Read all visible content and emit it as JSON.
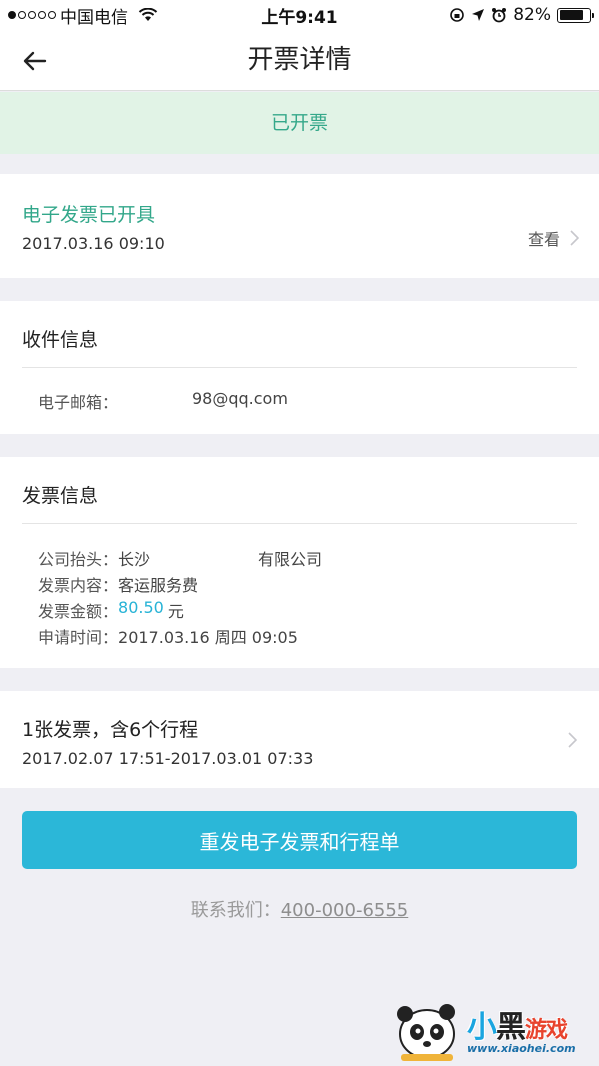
{
  "status_bar": {
    "carrier": "中国电信",
    "time": "上午9:41",
    "battery": "82%",
    "battery_level": 0.82
  },
  "nav": {
    "title": "开票详情"
  },
  "banner": {
    "status": "已开票"
  },
  "einvoice": {
    "title": "电子发票已开具",
    "time": "2017.03.16 09:10",
    "view_label": "查看"
  },
  "recipient": {
    "title": "收件信息",
    "email_label": "电子邮箱：",
    "email_value": "98@qq.com"
  },
  "invoice": {
    "title": "发票信息",
    "company_label": "公司抬头：",
    "company_part1": "长沙",
    "company_part2": "有限公司",
    "content_label": "发票内容：",
    "content_value": "客运服务费",
    "amount_label": "发票金额：",
    "amount_value": "80.50",
    "amount_unit": "元",
    "apply_label": "申请时间：",
    "apply_value": "2017.03.16 周四 09:05"
  },
  "trips": {
    "summary": "1张发票，含6个行程",
    "range": "2017.02.07 17:51-2017.03.01 07:33"
  },
  "actions": {
    "resend_label": "重发电子发票和行程单"
  },
  "contact": {
    "label": "联系我们：",
    "phone": "400-000-6555"
  },
  "watermark": {
    "brand_a": "小",
    "brand_b": "黑",
    "brand_c": "游戏",
    "url": "www.xiaohei.com"
  },
  "colors": {
    "accent_green": "#32a78a",
    "banner_bg": "#e1f3e6",
    "button_blue": "#2bb7d8",
    "amount_blue": "#27b3d6"
  }
}
